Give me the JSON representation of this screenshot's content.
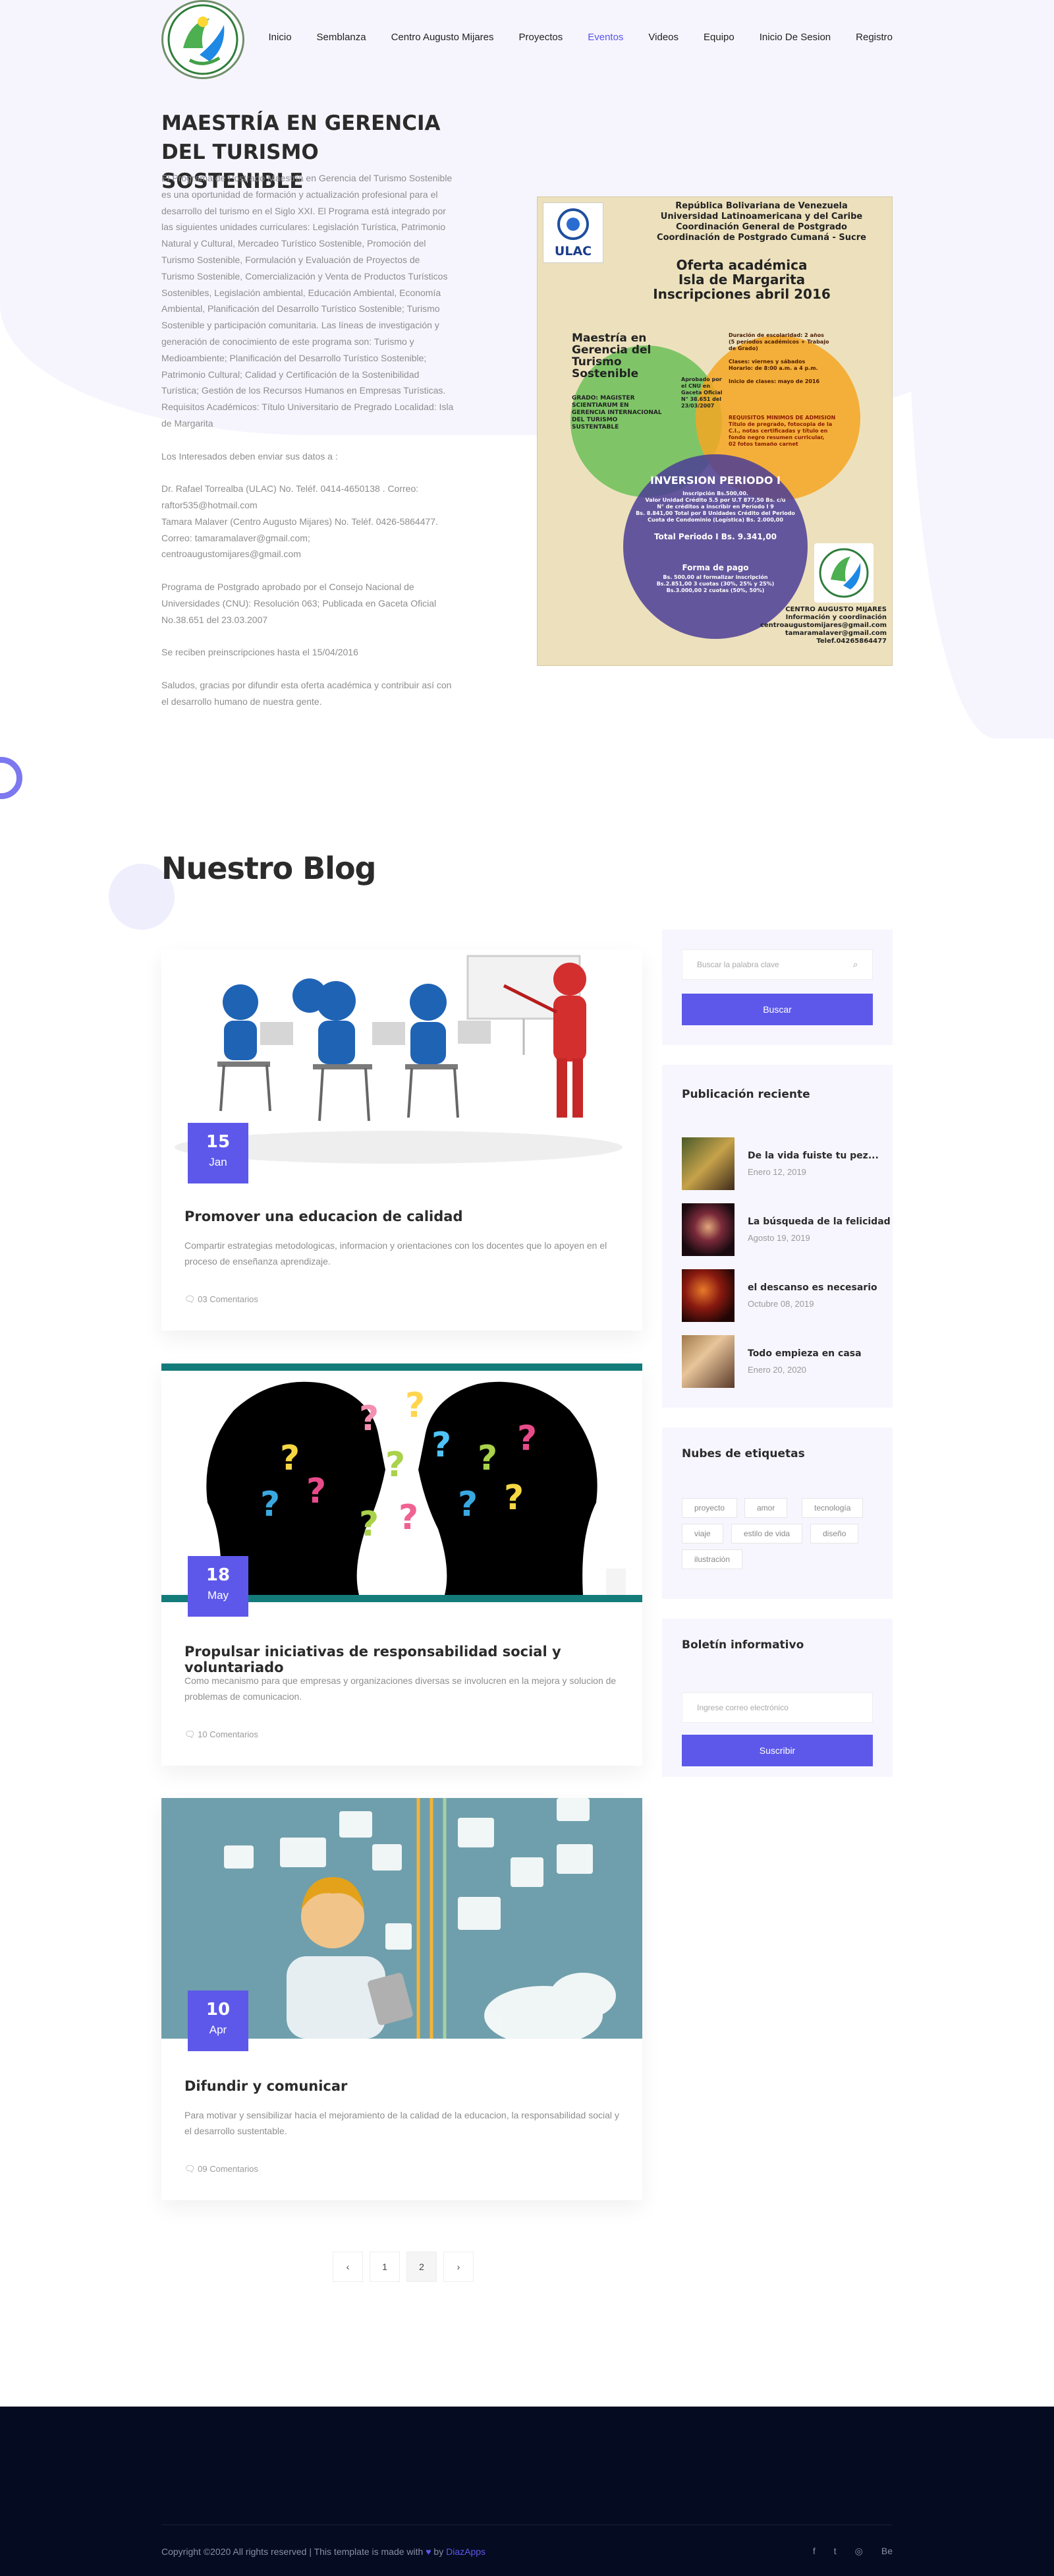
{
  "nav": {
    "items": [
      "Inicio",
      "Semblanza",
      "Centro Augusto Mijares",
      "Proyectos",
      "Eventos",
      "Videos",
      "Equipo",
      "Inicio De Sesion",
      "Registro"
    ],
    "active": "Eventos"
  },
  "event": {
    "title": "MAESTRÍA EN GERENCIA DEL TURISMO SOSTENIBLE",
    "paragraphs": [
      "El Programa de Postrado Maestría en Gerencia del Turismo Sostenible es una oportunidad de formación y actualización profesional para el desarrollo del turismo en el Siglo XXI. El Programa está integrado por las siguientes unidades curriculares: Legislación Turística, Patrimonio Natural y Cultural, Mercadeo Turístico Sostenible, Promoción del Turismo Sostenible, Formulación y Evaluación de Proyectos de Turismo Sostenible, Comercialización y Venta de Productos Turísticos Sostenibles, Legislación ambiental, Educación Ambiental, Economía Ambiental, Planificación del Desarrollo Turístico Sostenible; Turismo Sostenible y participación comunitaria. Las líneas de investigación y generación de conocimiento de este programa son: Turismo y Medioambiente; Planificación del Desarrollo Turístico Sostenible; Patrimonio Cultural; Calidad y Certificación de la Sostenibilidad Turística; Gestión de los Recursos Humanos en Empresas Turísticas. Requisitos Académicos: Título Universitario de Pregrado Localidad: Isla de Margarita",
      "Los Interesados deben enviar sus datos a :",
      "Dr. Rafael Torrealba (ULAC) No. Teléf. 0414-4650138 . Correo: raftor535@hotmail.com\nTamara Malaver (Centro Augusto Mijares) No. Teléf. 0426-5864477.\nCorreo: tamaramalaver@gmail.com;\ncentroaugustomijares@gmail.com",
      "Programa de Postgrado aprobado por el Consejo Nacional de Universidades (CNU): Resolución 063; Publicada en Gaceta Oficial No.38.651 del 23.03.2007",
      "Se reciben preinscripciones hasta el 15/04/2016",
      "Saludos, gracias por difundir esta oferta académica y contribuir así con el desarrollo humano de nuestra gente."
    ]
  },
  "flyer": {
    "header": "República Bolivariana de Venezuela\nUniversidad Latinoamericana y del Caribe\nCoordinación General de Postgrado\nCoordinación de Postgrado Cumaná - Sucre",
    "ulac": "ULAC",
    "headline": "Oferta académica\nIsla de Margarita\nInscripciones abril 2016",
    "green": "Maestría en\nGerencia del\nTurismo\nSostenible",
    "green_sub": "GRADO: MAGISTER\nSCIENTIARUM EN\nGERENCIA INTERNACIONAL\nDEL TURISMO\nSUSTENTABLE",
    "orange": "Duración de escolaridad: 2 años\n(5 períodos académicos + Trabajo\nde Grado)\n\nClases: viernes y sábados\nHorario: de 8:00 a.m. a 4 p.m.\n\nInicio de clases: mayo de 2016",
    "orange_sub": "REQUISITOS MINIMOS DE ADMISION\nTítulo de pregrado, fotocopia de la\nC.I., notas certificadas y título en\nfondo negro resumen curricular,\n02 fotos tamaño carnet",
    "center": "Aprobado por\nel CNU en\nGaceta Oficial\nN° 38.651 del\n23/03/2007",
    "blue_title": "INVERSION PERIODO I",
    "blue": "Inscripción Bs.500,00.\nValor Unidad Crédito 5.5 por U.T 877,50 Bs. c/u\nN° de créditos a inscribir en Período I 9\nBs. 8.841,00 Total por 8 Unidades Crédito del Periodo\nCuota de Condominio (Logística) Bs. 2.000,00",
    "total": "Total Periodo I Bs. 9.341,00",
    "pago_title": "Forma de pago",
    "pago": "Bs. 500,00 al formalizar inscripción\nBs.2.851,00 3 cuotas (30%, 25% y 25%)\nBs.3.000,00 2 cuotas (50%, 50%)",
    "footer": "CENTRO AUGUSTO MIJARES\nInformación y coordinación\ncentroaugustomijares@gmail.com\ntamaramalaver@gmail.com\nTelef.04265864477"
  },
  "blog": {
    "heading": "Nuestro Blog",
    "posts": [
      {
        "day": "15",
        "month": "Jan",
        "title": "Promover una educacion de calidad",
        "desc": "Compartir estrategias metodologicas, informacion y orientaciones con los docentes que lo apoyen en el proceso de enseñanza aprendizaje.",
        "comments": "03 Comentarios"
      },
      {
        "day": "18",
        "month": "May",
        "title": "Propulsar iniciativas de responsabilidad social y voluntariado",
        "desc": "Como mecanismo para que empresas y organizaciones diversas se involucren en la mejora y solucion de problemas de comunicacion.",
        "comments": "10 Comentarios"
      },
      {
        "day": "10",
        "month": "Apr",
        "title": "Difundir y comunicar",
        "desc": "Para motivar y sensibilizar hacia el mejoramiento de la calidad de la educacion, la responsabilidad social y el desarrollo sustentable.",
        "comments": "09 Comentarios"
      }
    ],
    "pagination": [
      "‹",
      "1",
      "2",
      "›"
    ],
    "current_page": "2"
  },
  "sidebar": {
    "search_placeholder": "Buscar la palabra clave",
    "search_button": "Buscar",
    "recent_title": "Publicación reciente",
    "recent": [
      {
        "title": "De la vida fuiste tu pez...",
        "date": "Enero 12, 2019"
      },
      {
        "title": "La búsqueda de la felicidad",
        "date": "Agosto 19, 2019"
      },
      {
        "title": "el descanso es necesario",
        "date": "Octubre 08, 2019"
      },
      {
        "title": "Todo empieza en casa",
        "date": "Enero 20, 2020"
      }
    ],
    "tags_title": "Nubes de etiquetas",
    "tags": [
      "proyecto",
      "amor",
      "tecnología",
      "viaje",
      "estilo de vida",
      "diseño",
      "ilustración"
    ],
    "news_title": "Boletín informativo",
    "news_placeholder": "Ingrese correo electrónico",
    "news_button": "Suscribir"
  },
  "footer": {
    "copy_pre": "Copyright ©2020 All rights reserved | This template is made with",
    "heart": "♥",
    "by": "by",
    "brand": "DiazApps",
    "social": [
      "f",
      "t",
      "◎",
      "Be"
    ]
  },
  "colors": {
    "accent": "#5d58ea",
    "footer_bg": "#050b20",
    "teal": "#137c7a"
  }
}
